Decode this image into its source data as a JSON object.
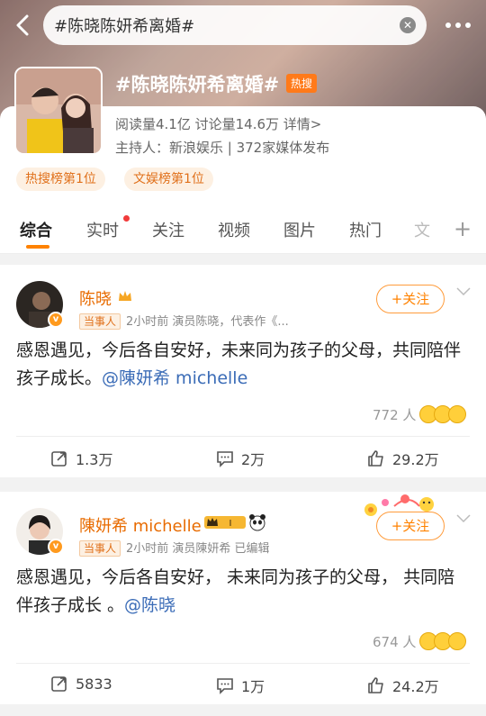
{
  "search": {
    "query": "#陈晓陈妍希离婚#"
  },
  "topic": {
    "title": "#陈晓陈妍希离婚#",
    "hot_badge": "热搜",
    "stats": "阅读量4.1亿   讨论量14.6万   详情>",
    "host": "主持人：新浪娱乐 | 372家媒体发布",
    "ranks": [
      "热搜榜第1位",
      "文娱榜第1位"
    ]
  },
  "tabs": [
    "综合",
    "实时",
    "关注",
    "视频",
    "图片",
    "热门",
    "文"
  ],
  "posts": [
    {
      "author": "陈晓",
      "role": "当事人",
      "meta": "2小时前   演员陈晓，代表作《...",
      "follow": "+关注",
      "text": "感恩遇见，今后各自安好，未来同为孩子的父母，共同陪伴孩子成长。",
      "mention": "@陳妍希 michelle",
      "reactions": "772 人",
      "reposts": "1.3万",
      "comments": "2万",
      "likes": "29.2万"
    },
    {
      "author": "陳妍希 michelle",
      "role": "当事人",
      "meta": "2小时前   演员陳妍希   已编辑",
      "follow": "+关注",
      "text": "感恩遇见，今后各自安好， 未来同为孩子的父母， 共同陪伴孩子成长 。",
      "mention": "@陈晓",
      "reactions": "674 人",
      "reposts": "5833",
      "comments": "1万",
      "likes": "24.2万"
    }
  ],
  "colors": {
    "accent": "#ff8200",
    "mention": "#3b6cb7"
  }
}
